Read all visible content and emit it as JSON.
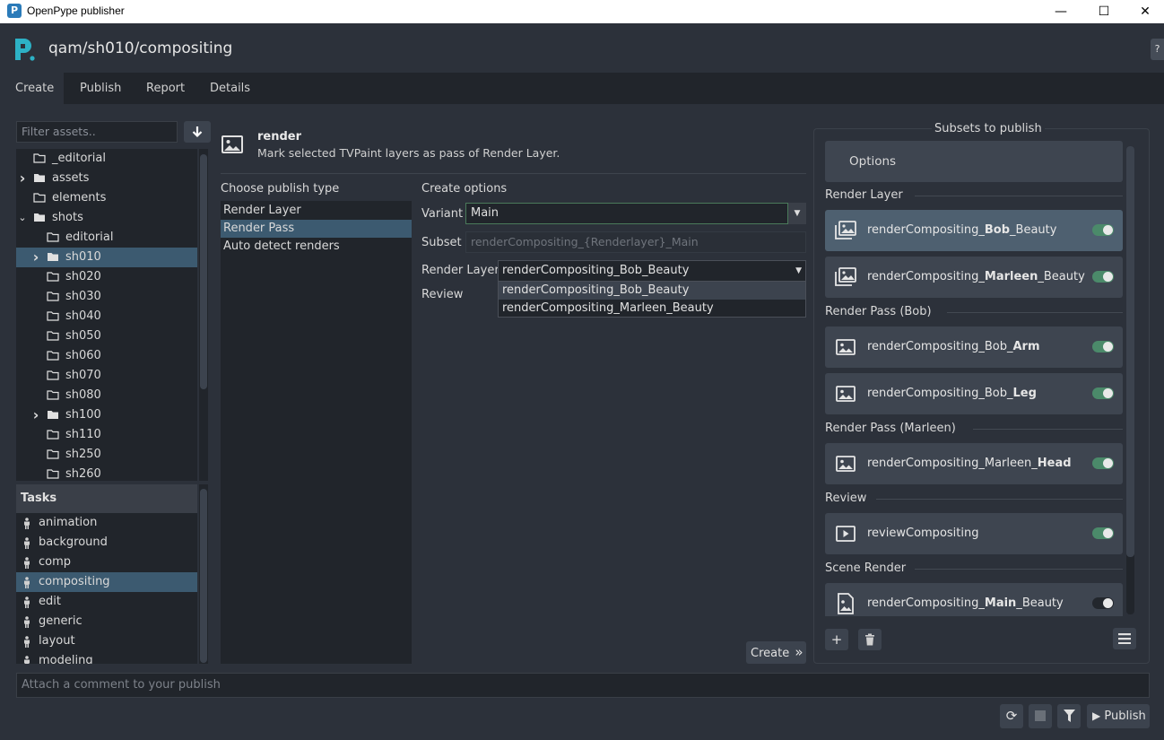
{
  "window": {
    "title": "OpenPype publisher",
    "icon_letter": "P"
  },
  "header": {
    "context": "qam/sh010/compositing",
    "help_label": "?"
  },
  "tabs": [
    {
      "label": "Create",
      "active": true
    },
    {
      "label": "Publish"
    },
    {
      "label": "Report"
    },
    {
      "label": "Details"
    }
  ],
  "assets": {
    "filter_placeholder": "Filter assets..",
    "items": [
      {
        "label": "_editorial",
        "expandable": false
      },
      {
        "label": "assets",
        "expandable": true
      },
      {
        "label": "elements",
        "expandable": false
      },
      {
        "label": "shots",
        "expandable": true,
        "expanded": true
      },
      {
        "label": "editorial",
        "expandable": false
      },
      {
        "label": "sh010",
        "expandable": true,
        "selected": true
      },
      {
        "label": "sh020",
        "expandable": false
      },
      {
        "label": "sh030",
        "expandable": false
      },
      {
        "label": "sh040",
        "expandable": false
      },
      {
        "label": "sh050",
        "expandable": false
      },
      {
        "label": "sh060",
        "expandable": false
      },
      {
        "label": "sh070",
        "expandable": false
      },
      {
        "label": "sh080",
        "expandable": false
      },
      {
        "label": "sh100",
        "expandable": true
      },
      {
        "label": "sh110",
        "expandable": false
      },
      {
        "label": "sh250",
        "expandable": false
      },
      {
        "label": "sh260",
        "expandable": false
      }
    ]
  },
  "tasks": {
    "header": "Tasks",
    "items": [
      "animation",
      "background",
      "comp",
      "compositing",
      "edit",
      "generic",
      "layout",
      "modeling"
    ],
    "selected": "compositing"
  },
  "creator": {
    "name": "render",
    "description": "Mark selected TVPaint layers as pass of Render Layer.",
    "choose_label": "Choose publish type",
    "types": [
      "Render Layer",
      "Render Pass",
      "Auto detect renders"
    ],
    "selected_type": "Render Pass"
  },
  "create_options": {
    "title": "Create options",
    "variant_label": "Variant",
    "variant_value": "Main",
    "subset_label": "Subset",
    "subset_value": "renderCompositing_{Renderlayer}_Main",
    "render_layer_label": "Render Layer",
    "render_layer_value": "renderCompositing_Bob_Beauty",
    "render_layer_options": [
      "renderCompositing_Bob_Beauty",
      "renderCompositing_Marleen_Beauty"
    ],
    "review_label": "Review",
    "create_button": "Create"
  },
  "subsets": {
    "title": "Subsets to publish",
    "options_label": "Options",
    "groups": [
      {
        "label": "Render Layer",
        "items": [
          {
            "prefix": "renderCompositing_",
            "bold": "Bob",
            "suffix": "_Beauty",
            "enabled": true,
            "selected": true,
            "icon": "layers-icon"
          },
          {
            "prefix": "renderCompositing_",
            "bold": "Marleen",
            "suffix": "_Beauty",
            "enabled": true,
            "icon": "layers-icon"
          }
        ]
      },
      {
        "label": "Render Pass (Bob)",
        "items": [
          {
            "prefix": "renderCompositing_Bob_",
            "bold": "Arm",
            "suffix": "",
            "enabled": true,
            "icon": "image-icon"
          },
          {
            "prefix": "renderCompositing_Bob_",
            "bold": "Leg",
            "suffix": "",
            "enabled": true,
            "icon": "image-icon"
          }
        ]
      },
      {
        "label": "Render Pass (Marleen)",
        "items": [
          {
            "prefix": "renderCompositing_Marleen_",
            "bold": "Head",
            "suffix": "",
            "enabled": true,
            "icon": "image-icon"
          }
        ]
      },
      {
        "label": "Review",
        "items": [
          {
            "prefix": "reviewCompositing",
            "bold": "",
            "suffix": "",
            "enabled": true,
            "icon": "play-icon"
          }
        ]
      },
      {
        "label": "Scene Render",
        "items": [
          {
            "prefix": "renderCompositing_",
            "bold": "Main",
            "suffix": "_Beauty",
            "enabled": false,
            "icon": "file-image-icon"
          }
        ]
      }
    ]
  },
  "footer": {
    "comment_placeholder": "Attach a comment to your publish",
    "publish_label": "Publish"
  },
  "colors": {
    "accent": "#3c5a70",
    "toggle_on": "#4b8a6a",
    "background": "#2c313a"
  }
}
